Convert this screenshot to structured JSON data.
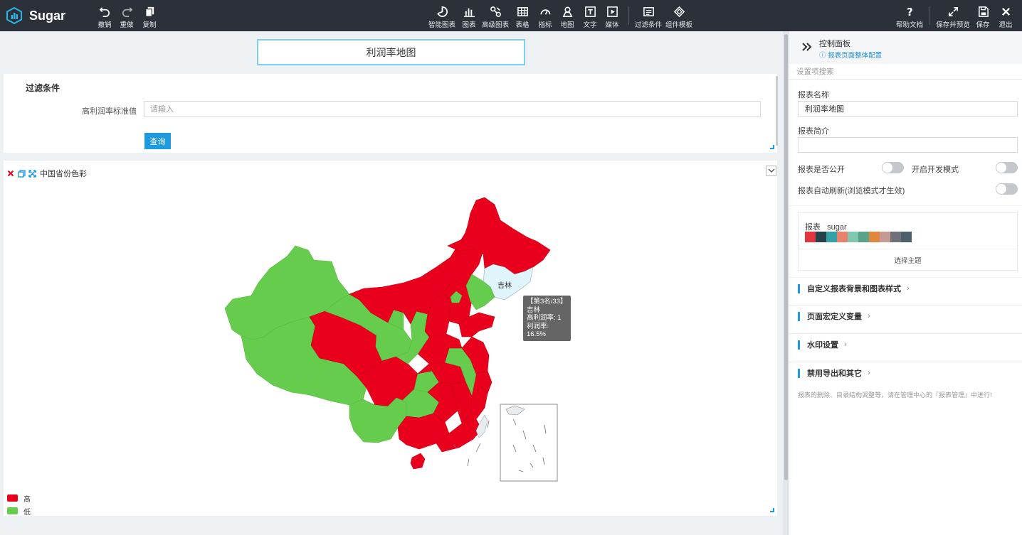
{
  "app": {
    "name": "Sugar"
  },
  "toolbar": {
    "left": [
      {
        "label": "撤销",
        "icon": "undo-icon"
      },
      {
        "label": "重做",
        "icon": "redo-icon"
      },
      {
        "label": "复制",
        "icon": "copy-icon"
      }
    ],
    "center": [
      {
        "label": "智能图表",
        "icon": "smart-chart-icon"
      },
      {
        "label": "图表",
        "icon": "bar-chart-icon"
      },
      {
        "label": "高级图表",
        "icon": "advanced-chart-icon"
      },
      {
        "label": "表格",
        "icon": "table-icon"
      },
      {
        "label": "指标",
        "icon": "gauge-icon"
      },
      {
        "label": "地图",
        "icon": "map-pin-icon"
      },
      {
        "label": "文字",
        "icon": "text-icon"
      },
      {
        "label": "媒体",
        "icon": "media-icon"
      },
      {
        "label": "过滤条件",
        "icon": "filter-icon"
      },
      {
        "label": "组件模板",
        "icon": "template-icon"
      }
    ],
    "right": [
      {
        "label": "帮助文档",
        "icon": "help-icon"
      },
      {
        "label": "保存并预览",
        "icon": "expand-icon"
      },
      {
        "label": "保存",
        "icon": "save-icon"
      },
      {
        "label": "退出",
        "icon": "close-icon"
      }
    ]
  },
  "report": {
    "title": "利润率地图"
  },
  "filter": {
    "title": "过滤条件",
    "field_label": "高利润率标准值",
    "field_placeholder": "请输入",
    "field_value": "",
    "query_button": "查询"
  },
  "map": {
    "name": "中国省份色彩",
    "highlight_label": "吉林",
    "tooltip": {
      "rank": "【第3名/33】",
      "province": "吉林",
      "line1": "高利润率: 1",
      "line2": "利润率: 16.5%"
    },
    "legend": [
      {
        "label": "高",
        "color": "#e8001c"
      },
      {
        "label": "低",
        "color": "#66cc4d"
      }
    ],
    "colors": {
      "high": "#e8001c",
      "low": "#66cc4d",
      "hover": "#dff4fb",
      "other": "#e9ecee"
    }
  },
  "panel": {
    "title": "控制面板",
    "subtitle": "报表页面整体配置",
    "search_placeholder": "设置项搜索",
    "report_name_label": "报表名称",
    "report_name_value": "利润率地图",
    "report_desc_label": "报表简介",
    "report_desc_value": "",
    "public_label": "报表是否公开",
    "dev_mode_label": "开启开发模式",
    "auto_refresh_label": "报表自动刷新(浏览模式才生效)",
    "theme": {
      "name": "报表",
      "value": "sugar",
      "colors": [
        "#e2343f",
        "#26414a",
        "#32a2a8",
        "#e9826a",
        "#7fc7b1",
        "#5aa38b",
        "#e0873e",
        "#c49a92",
        "#6e7177",
        "#4a5f6a"
      ],
      "select_label": "选择主题"
    },
    "sections": [
      "自定义报表背景和图表样式",
      "页面宏定义变量",
      "水印设置",
      "禁用导出和其它"
    ],
    "note": "报表的删除、目录结构调整等，请在管理中心的『报表管理』中进行!"
  }
}
